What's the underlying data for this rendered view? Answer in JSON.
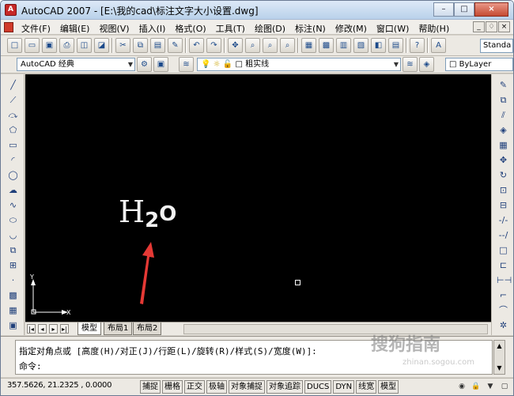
{
  "window": {
    "title": "AutoCAD 2007 - [E:\\我的cad\\标注文字大小设置.dwg]",
    "app_icon": "A",
    "buttons": [
      "–",
      "□",
      "×"
    ]
  },
  "menu": {
    "items": [
      "文件(F)",
      "编辑(E)",
      "视图(V)",
      "插入(I)",
      "格式(O)",
      "工具(T)",
      "绘图(D)",
      "标注(N)",
      "修改(M)",
      "窗口(W)",
      "帮助(H)"
    ],
    "mdi_buttons": [
      "_",
      "♢",
      "×"
    ]
  },
  "toolbar1": {
    "icons": [
      "new-icon",
      "open-icon",
      "save-icon",
      "print-icon",
      "preview-icon",
      "publish-icon",
      "sep",
      "cut-icon",
      "copy-icon",
      "paste-icon",
      "match-icon",
      "sep",
      "undo-icon",
      "redo-icon",
      "sep",
      "pan-icon",
      "zoom-realtime-icon",
      "zoom-window-icon",
      "zoom-previous-icon",
      "sep",
      "properties-icon",
      "designcenter-icon",
      "toolpalette-icon",
      "sheetset-icon",
      "markup-icon",
      "calculator-icon",
      "sep",
      "help-icon",
      "sep",
      "text-style-icon"
    ],
    "glyphs": [
      "□",
      "▭",
      "▣",
      "⎙",
      "◫",
      "◪",
      "",
      "✂",
      "⧉",
      "▤",
      "✎",
      "",
      "↶",
      "↷",
      "",
      "✥",
      "⌕",
      "⌕",
      "⌕",
      "",
      "▦",
      "▩",
      "▥",
      "▧",
      "◧",
      "▤",
      "",
      "?",
      "",
      "A"
    ],
    "text_style_value": "Standa"
  },
  "toolbar2": {
    "workspace": "AutoCAD 经典",
    "layer": "粗实线",
    "color": "ByLayer"
  },
  "left_toolbar": {
    "icons": [
      "line-icon",
      "construction-line-icon",
      "polyline-icon",
      "polygon-icon",
      "rectangle-icon",
      "arc-icon",
      "circle-icon",
      "revision-cloud-icon",
      "spline-icon",
      "ellipse-icon",
      "ellipse-arc-icon",
      "insert-block-icon",
      "make-block-icon",
      "point-icon",
      "hatch-icon",
      "gradient-icon",
      "region-icon"
    ],
    "glyphs": [
      "╱",
      "⟋",
      "⤼",
      "⬠",
      "▭",
      "◜",
      "◯",
      "☁",
      "∿",
      "⬭",
      "◡",
      "⧉",
      "⊞",
      "·",
      "▩",
      "▦",
      "▣"
    ]
  },
  "right_toolbar": {
    "icons": [
      "erase-icon",
      "copy-object-icon",
      "mirror-icon",
      "offset-icon",
      "array-icon",
      "move-icon",
      "rotate-icon",
      "scale-icon",
      "stretch-icon",
      "trim-icon",
      "extend-icon",
      "break-at-point-icon",
      "break-icon",
      "join-icon",
      "chamfer-icon",
      "fillet-icon",
      "explode-icon"
    ],
    "glyphs": [
      "✎",
      "⧉",
      "⫽",
      "◈",
      "▦",
      "✥",
      "↻",
      "⊡",
      "⊟",
      "-/-",
      "--/",
      "□",
      "⊏",
      "⊢⊣",
      "⌐",
      "⌒",
      "✲"
    ]
  },
  "canvas": {
    "text_main": "H",
    "text_sub": "2",
    "text_tail": "O",
    "ucs_x": "X",
    "ucs_y": "Y",
    "annotation_color": "#e53935"
  },
  "layout_tabs": {
    "nav": [
      "|◂",
      "◂",
      "▸",
      "▸|"
    ],
    "tabs": [
      "模型",
      "布局1",
      "布局2"
    ],
    "active": "模型"
  },
  "command": {
    "history": "指定对角点或 [高度(H)/对正(J)/行距(L)/旋转(R)/样式(S)/宽度(W)]:",
    "prompt": "命令:"
  },
  "status": {
    "coords": "357.5626, 21.2325 , 0.0000",
    "toggles": [
      "捕捉",
      "栅格",
      "正交",
      "极轴",
      "对象捕捉",
      "对象追踪",
      "DUCS",
      "DYN",
      "线宽",
      "模型"
    ]
  },
  "watermark": {
    "main": "搜狗指南",
    "sub": "zhinan.sogou.com"
  }
}
